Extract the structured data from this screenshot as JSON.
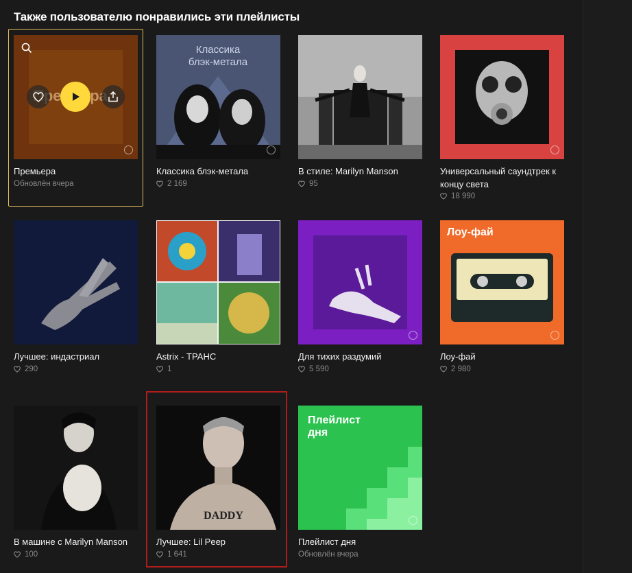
{
  "heading": "Также пользователю понравились эти плейлисты",
  "playlists": [
    {
      "title": "Премьера",
      "meta": "Обновлён вчера",
      "likes": null,
      "cover_text": "Премьера"
    },
    {
      "title": "Классика блэк-метала",
      "meta": "",
      "likes": "2 169",
      "cover_text": "Классика\nблэк-метала"
    },
    {
      "title": "В стиле: Marilyn Manson",
      "meta": "",
      "likes": "95"
    },
    {
      "title": "Универсальный саундтрек к концу света",
      "meta": "",
      "likes": "18 990"
    },
    {
      "title": "Лучшее: индастриал",
      "meta": "",
      "likes": "290"
    },
    {
      "title": "Astrix - ТРАНС",
      "meta": "",
      "likes": "1"
    },
    {
      "title": "Для тихих раздумий",
      "meta": "",
      "likes": "5 590"
    },
    {
      "title": "Лоу-фай",
      "meta": "",
      "likes": "2 980",
      "cover_text": "Лоу-фай"
    },
    {
      "title": "В машине с Marilyn Manson",
      "meta": "",
      "likes": "100"
    },
    {
      "title": "Лучшее: Lil Peep",
      "meta": "",
      "likes": "1 641"
    },
    {
      "title": "Плейлист дня",
      "meta": "Обновлён вчера",
      "likes": null,
      "cover_text": "Плейлист\nдня"
    }
  ],
  "colors": {
    "accent_yellow": "#ffd83b",
    "hover_border": "#e7c15c",
    "selected_border": "#b01c1c",
    "background": "#1a1a1a"
  },
  "icons": {
    "search": "search-icon",
    "like": "heart-icon",
    "play": "play-icon",
    "share": "share-icon"
  }
}
